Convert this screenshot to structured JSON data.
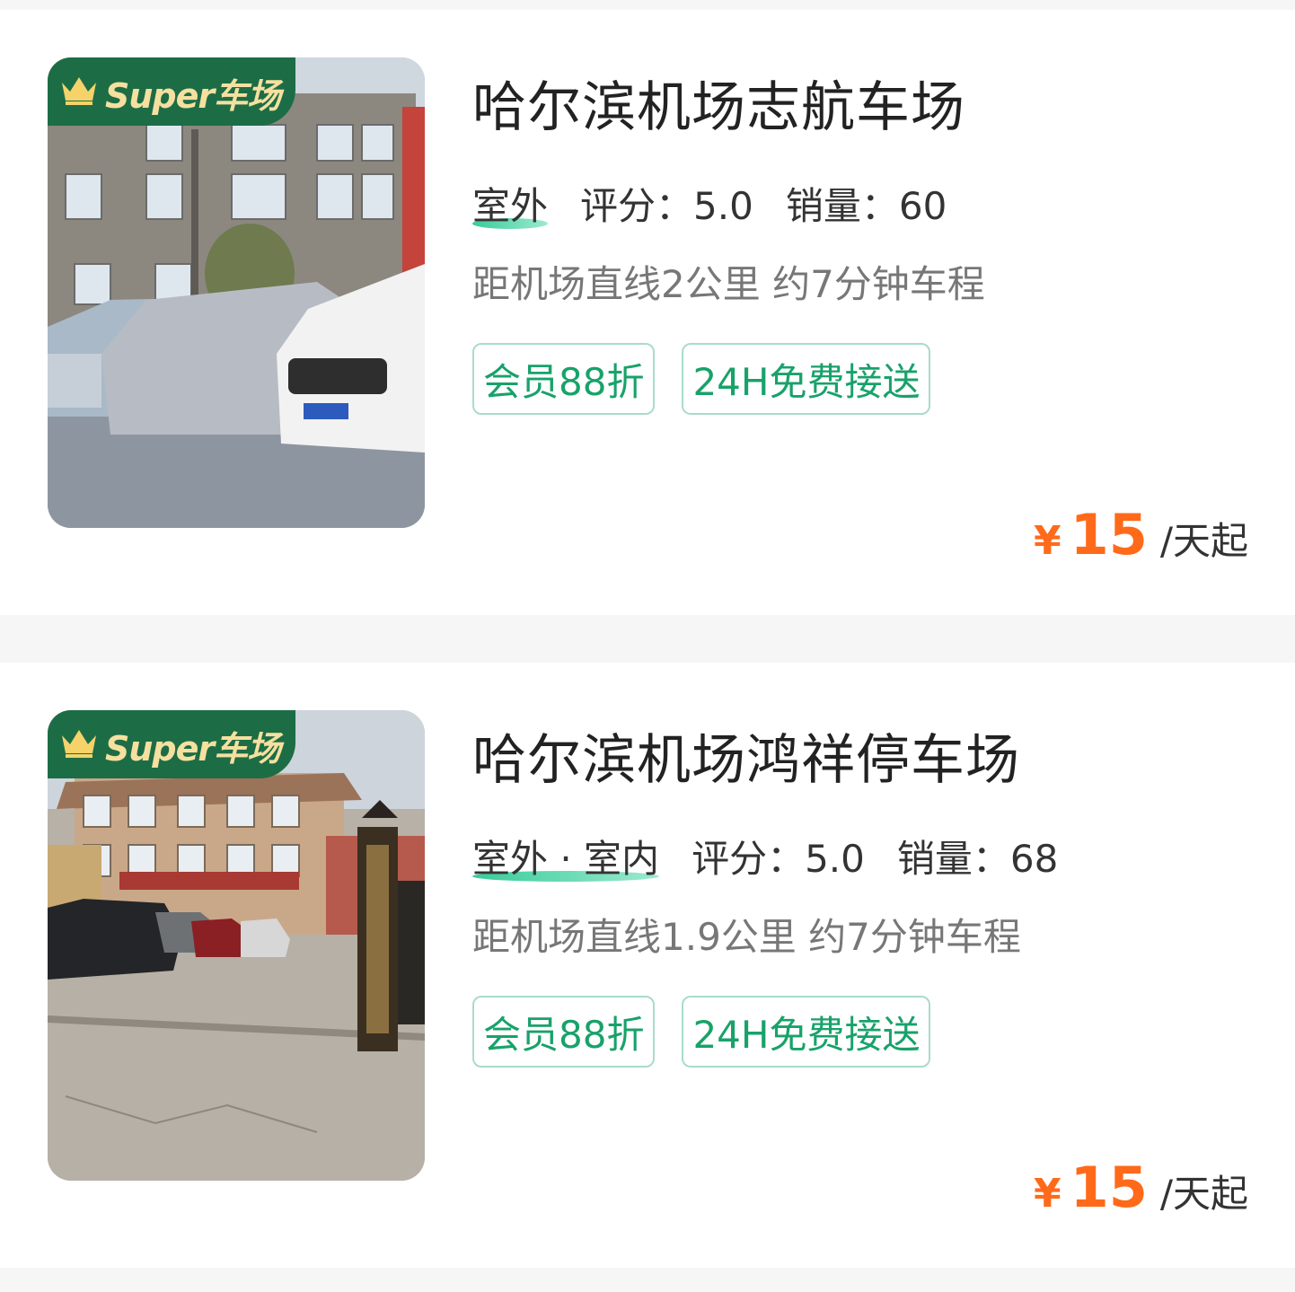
{
  "badge_text": "Super车场",
  "lots": [
    {
      "name": "哈尔滨机场志航车场",
      "location_type": "室外",
      "rating_label": "评分：",
      "rating": "5.0",
      "sales_label": "销量：",
      "sales": "60",
      "distance": "距机场直线2公里 约7分钟车程",
      "tags": [
        "会员88折",
        "24H免费接送"
      ],
      "currency": "¥",
      "price": "15",
      "price_unit": "/天起"
    },
    {
      "name": "哈尔滨机场鸿祥停车场",
      "location_type": "室外 · 室内",
      "rating_label": "评分：",
      "rating": "5.0",
      "sales_label": "销量：",
      "sales": "68",
      "distance": "距机场直线1.9公里 约7分钟车程",
      "tags": [
        "会员88折",
        "24H免费接送"
      ],
      "currency": "¥",
      "price": "15",
      "price_unit": "/天起"
    }
  ],
  "colors": {
    "accent_green": "#18a26a",
    "badge_green": "#1c6d45",
    "price_orange": "#ff6a1a"
  }
}
